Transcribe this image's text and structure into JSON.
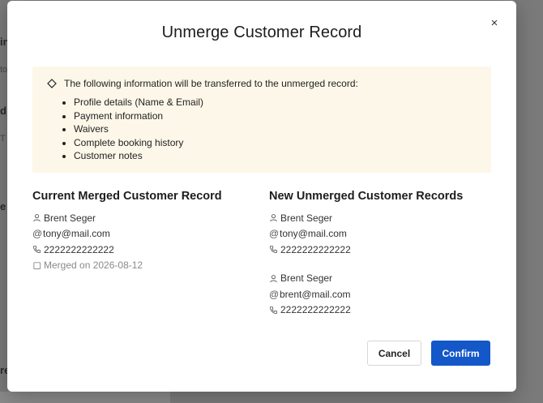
{
  "modal": {
    "title": "Unmerge Customer Record",
    "close_symbol": "×",
    "info": {
      "heading": "The following information will be transferred to the unmerged record:",
      "items": [
        "Profile details (Name & Email)",
        "Payment information",
        "Waivers",
        "Complete booking history",
        "Customer notes"
      ]
    },
    "current": {
      "title": "Current Merged Customer Record",
      "name": "Brent Seger",
      "email": "tony@mail.com",
      "phone": "2222222222222",
      "merged": "Merged on 2026-08-12"
    },
    "new_records": {
      "title": "New Unmerged Customer Records",
      "records": [
        {
          "name": "Brent Seger",
          "email": "tony@mail.com",
          "phone": "2222222222222"
        },
        {
          "name": "Brent Seger",
          "email": "brent@mail.com",
          "phone": "2222222222222"
        }
      ]
    },
    "buttons": {
      "cancel": "Cancel",
      "confirm": "Confirm"
    }
  },
  "background": {
    "fragments": [
      "in",
      "to",
      "d",
      "T",
      "e",
      "re"
    ]
  }
}
